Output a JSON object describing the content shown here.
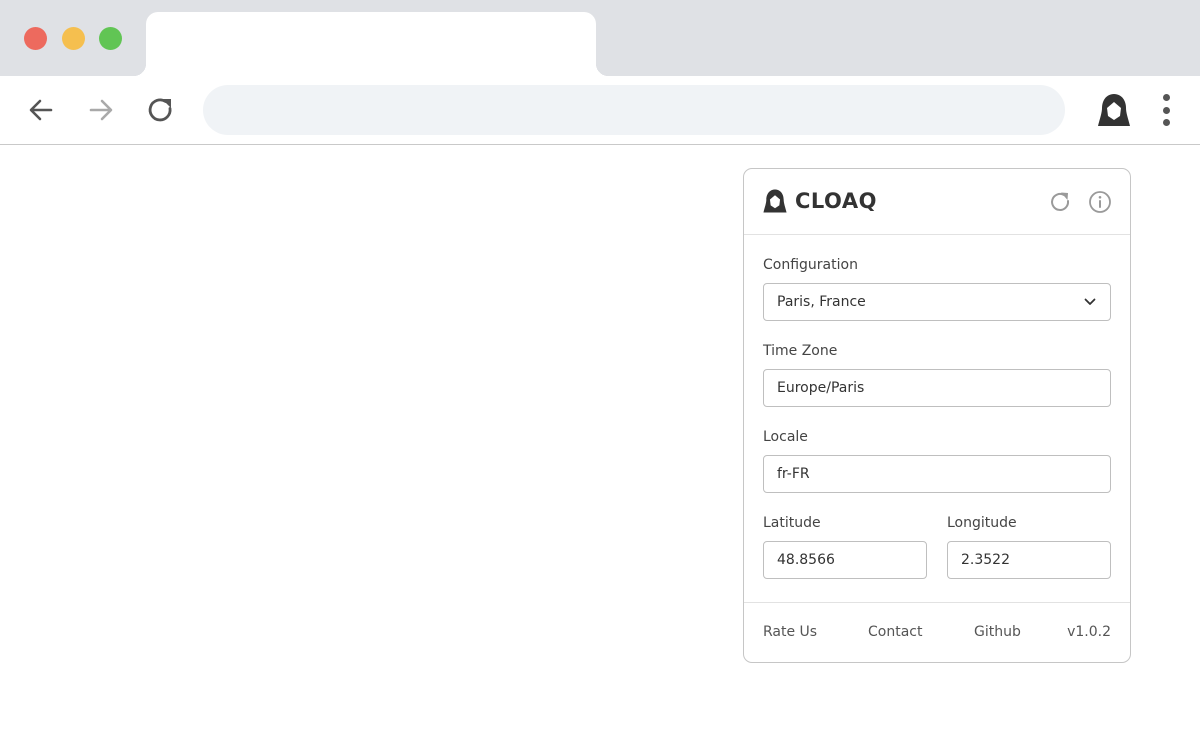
{
  "browser": {
    "tab_title": "",
    "address": {
      "value": "",
      "placeholder": ""
    },
    "window_controls": [
      "close",
      "minimize",
      "maximize"
    ],
    "nav_icons": [
      "back-arrow-icon",
      "forward-arrow-icon",
      "reload-icon"
    ],
    "extension_icon": "cloaq-hooded-figure-icon",
    "menu_icon": "kebab-menu-icon"
  },
  "popup": {
    "brand": "CLOAQ",
    "header_icons": [
      "refresh-icon",
      "info-icon"
    ],
    "fields": {
      "configuration": {
        "label": "Configuration",
        "value": "Paris, France"
      },
      "timezone": {
        "label": "Time Zone",
        "value": "Europe/Paris"
      },
      "locale": {
        "label": "Locale",
        "value": "fr-FR"
      },
      "latitude": {
        "label": "Latitude",
        "value": "48.8566"
      },
      "longitude": {
        "label": "Longitude",
        "value": "2.3522"
      }
    },
    "footer": {
      "rate": "Rate Us",
      "contact": "Contact",
      "github": "Github",
      "version": "v1.0.2"
    }
  },
  "colors": {
    "chrome_bg": "#dfe1e5",
    "address_bg": "#f0f3f6",
    "close": "#ed6a5e",
    "minimize": "#f5bf4f",
    "maximize": "#61c554"
  }
}
